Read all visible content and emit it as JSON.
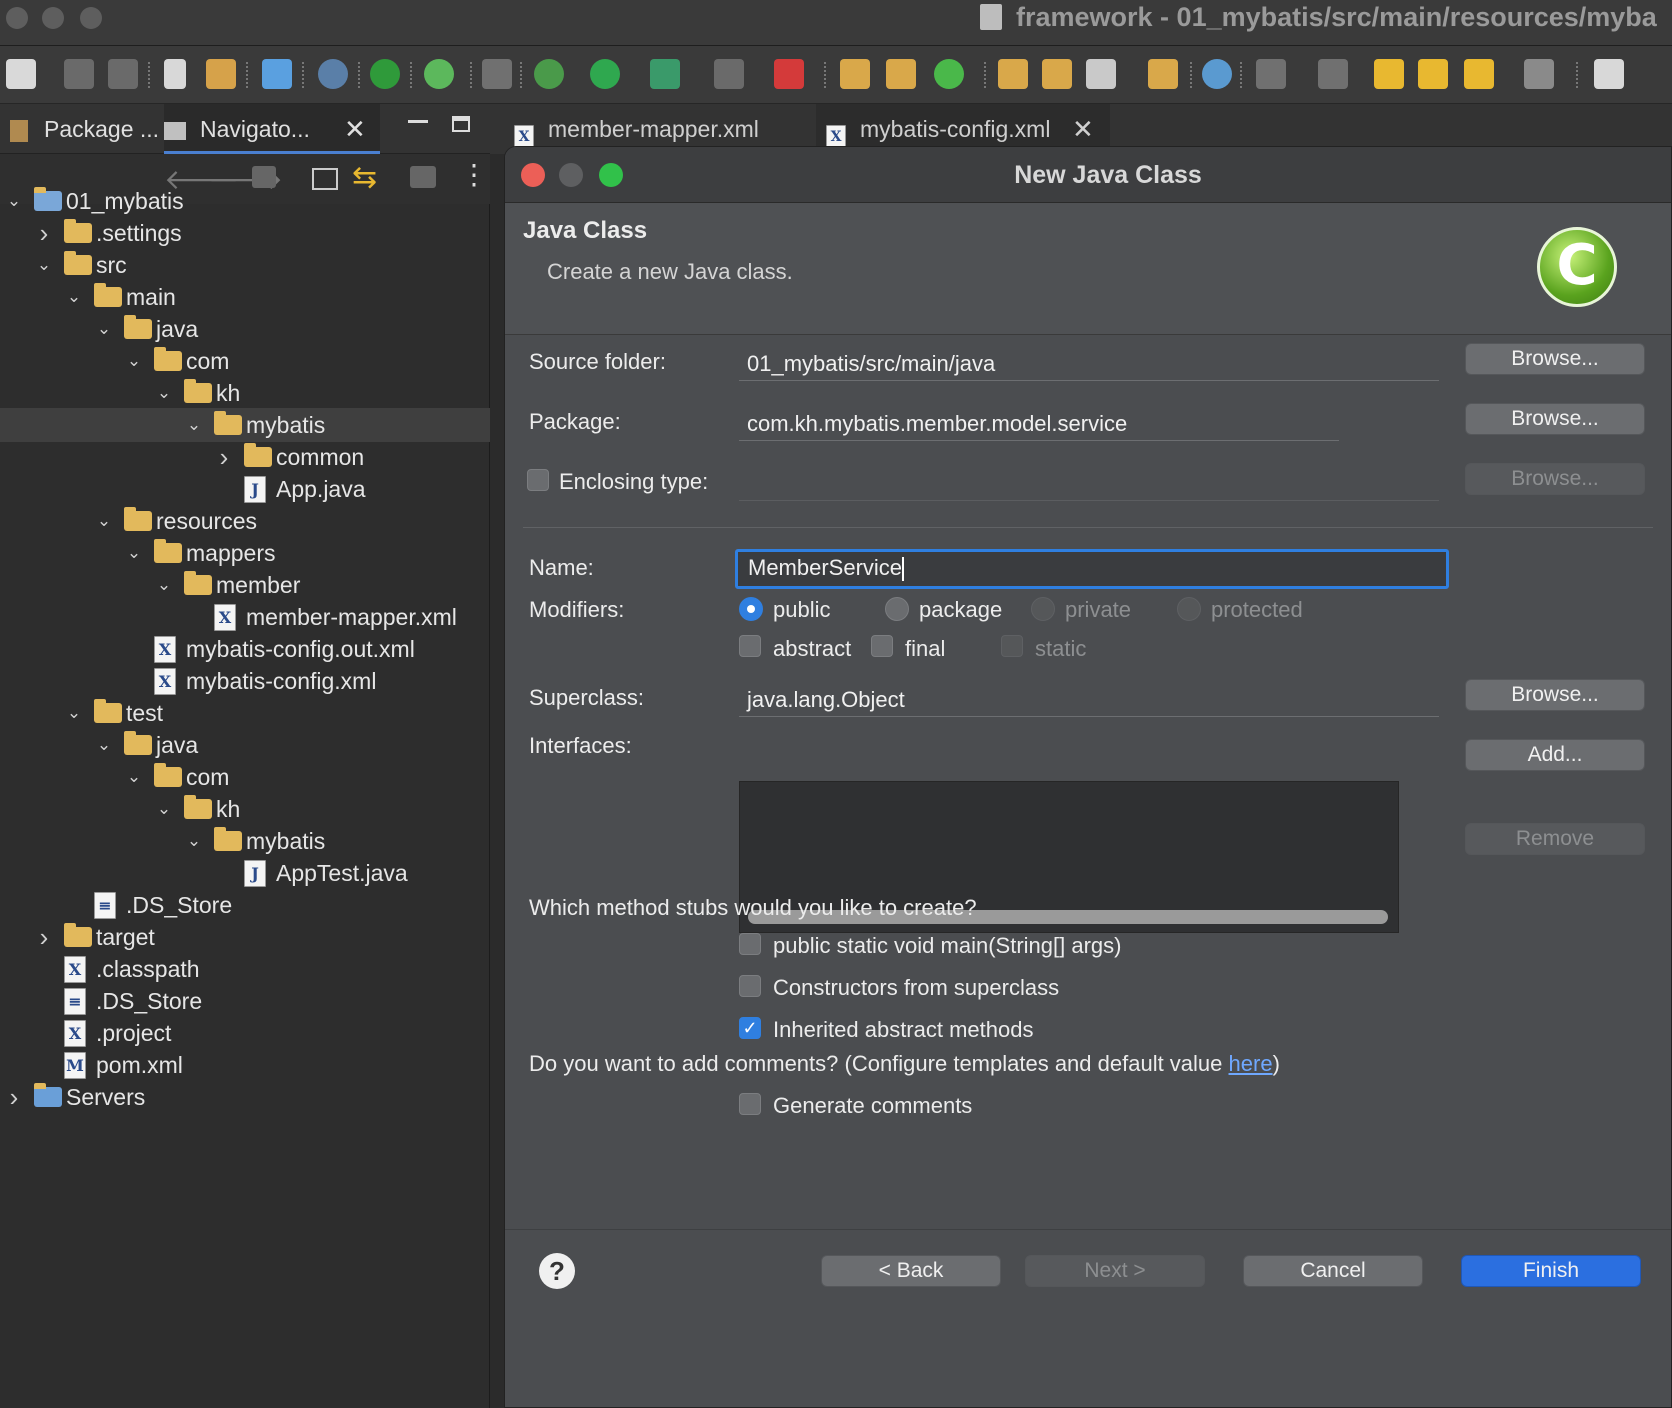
{
  "window": {
    "title": "framework - 01_mybatis/src/main/resources/myba"
  },
  "left_panel": {
    "tabs": [
      {
        "label": "Package ..."
      },
      {
        "label": "Navigato..."
      }
    ],
    "tree": [
      {
        "label": "01_mybatis"
      },
      {
        "label": ".settings"
      },
      {
        "label": "src"
      },
      {
        "label": "main"
      },
      {
        "label": "java"
      },
      {
        "label": "com"
      },
      {
        "label": "kh"
      },
      {
        "label": "mybatis"
      },
      {
        "label": "common"
      },
      {
        "label": "App.java"
      },
      {
        "label": "resources"
      },
      {
        "label": "mappers"
      },
      {
        "label": "member"
      },
      {
        "label": "member-mapper.xml"
      },
      {
        "label": "mybatis-config.out.xml"
      },
      {
        "label": "mybatis-config.xml"
      },
      {
        "label": "test"
      },
      {
        "label": "java"
      },
      {
        "label": "com"
      },
      {
        "label": "kh"
      },
      {
        "label": "mybatis"
      },
      {
        "label": "AppTest.java"
      },
      {
        "label": ".DS_Store"
      },
      {
        "label": "target"
      },
      {
        "label": ".classpath"
      },
      {
        "label": ".DS_Store"
      },
      {
        "label": ".project"
      },
      {
        "label": "pom.xml"
      },
      {
        "label": "Servers"
      }
    ]
  },
  "editor_tabs": [
    {
      "label": "member-mapper.xml"
    },
    {
      "label": "mybatis-config.xml"
    }
  ],
  "dialog": {
    "title": "New Java Class",
    "header_title": "Java Class",
    "header_desc": "Create a new Java class.",
    "labels": {
      "source_folder": "Source folder:",
      "package": "Package:",
      "enclosing_type": "Enclosing type:",
      "name": "Name:",
      "modifiers": "Modifiers:",
      "superclass": "Superclass:",
      "interfaces": "Interfaces:",
      "stubs_question": "Which method stubs would you like to create?",
      "comments_question": "Do you want to add comments? (Configure templates and default value ",
      "comments_link": "here",
      "comments_close": ")"
    },
    "values": {
      "source_folder": "01_mybatis/src/main/java",
      "package": "com.kh.mybatis.member.model.service",
      "enclosing_type": "",
      "name": "MemberService",
      "superclass": "java.lang.Object"
    },
    "modifiers": {
      "public": "public",
      "package": "package",
      "private": "private",
      "protected": "protected",
      "abstract": "abstract",
      "final": "final",
      "static": "static"
    },
    "stubs": {
      "main": "public static void main(String[] args)",
      "constructors": "Constructors from superclass",
      "inherited": "Inherited abstract methods"
    },
    "generate_comments": "Generate comments",
    "buttons": {
      "browse": "Browse...",
      "add": "Add...",
      "remove": "Remove",
      "back": "< Back",
      "next": "Next >",
      "cancel": "Cancel",
      "finish": "Finish"
    }
  }
}
